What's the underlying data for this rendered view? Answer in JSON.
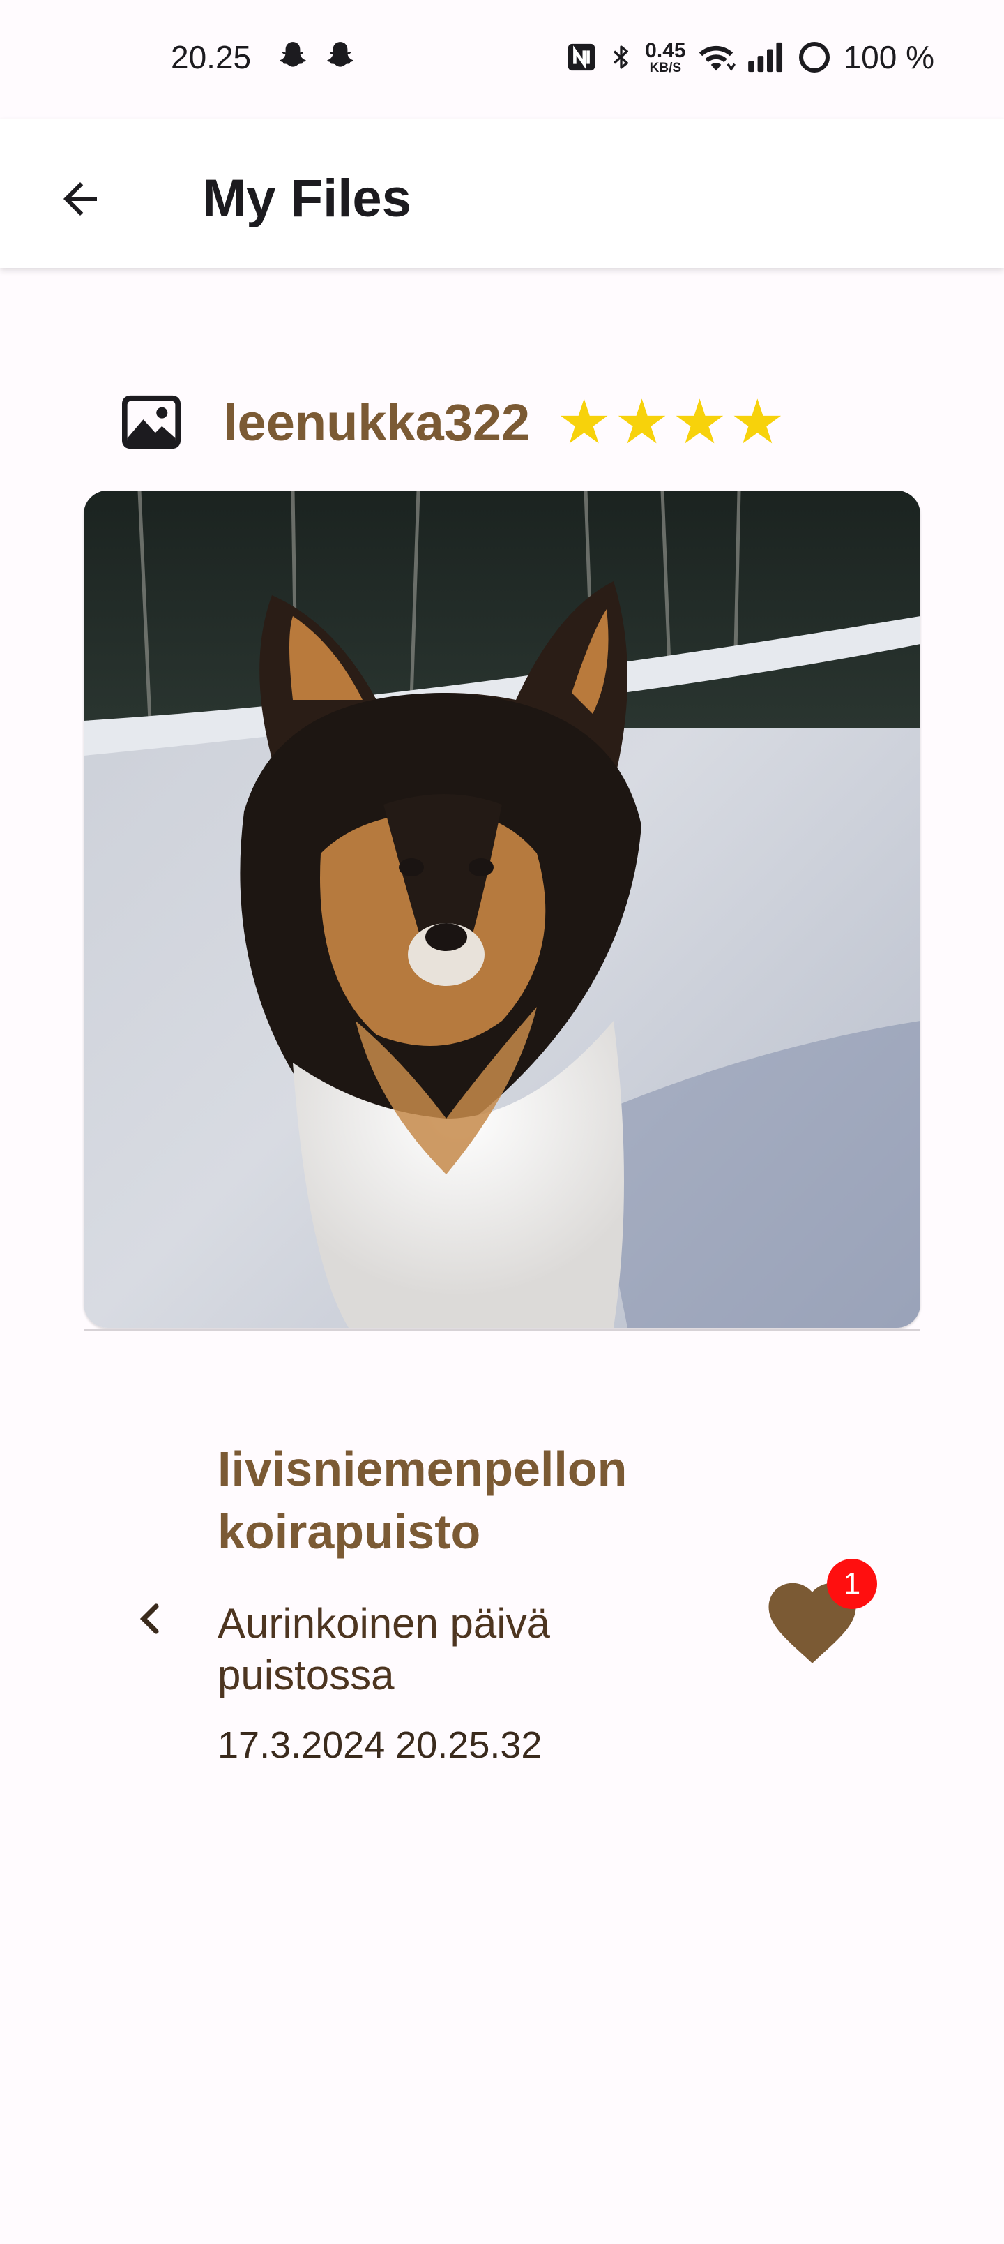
{
  "status_bar": {
    "time": "20.25",
    "net_speed_value": "0.45",
    "net_speed_unit": "KB/S",
    "battery": "100 %",
    "icons": [
      "snapchat-icon",
      "snapchat-icon",
      "nfc-icon",
      "bluetooth-icon",
      "wifi-icon",
      "signal-icon",
      "battery-ring-icon"
    ]
  },
  "app_bar": {
    "title": "My Files",
    "back_icon": "arrow-back-icon"
  },
  "post": {
    "type_icon": "image-icon",
    "username": "leenukka322",
    "rating": 4,
    "rating_stars": [
      "★",
      "★",
      "★",
      "★"
    ],
    "image_description_icon": "dog-photo",
    "place_name": "Iivisniemenpellon koirapuisto",
    "description": "Aurinkoinen päivä puistossa",
    "timestamp": "17.3.2024 20.25.32",
    "like_count": "1"
  },
  "colors": {
    "accent_brown": "#7b5a34",
    "star_yellow": "#f7d20b",
    "badge_red": "#ff0f0f",
    "background": "#fffbfe"
  }
}
